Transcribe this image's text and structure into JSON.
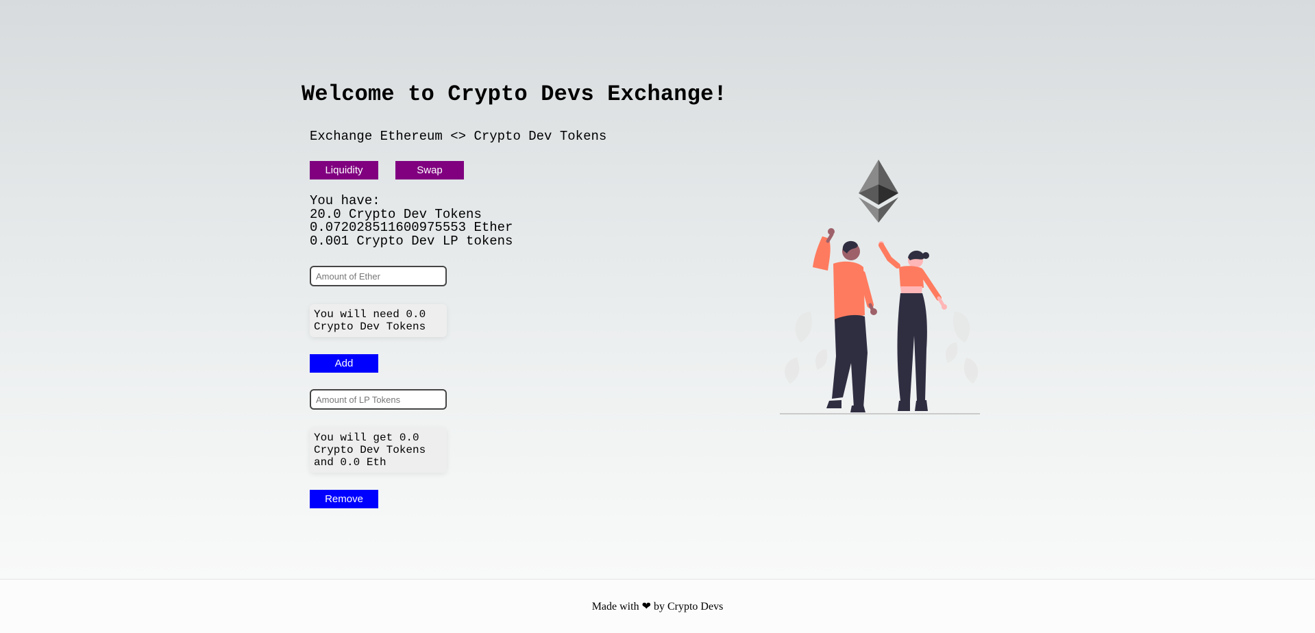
{
  "header": {
    "title": "Welcome to Crypto Devs Exchange!",
    "subtitle": "Exchange Ethereum <> Crypto Dev Tokens"
  },
  "tabs": {
    "liquidity_label": "Liquidity",
    "swap_label": "Swap"
  },
  "balances": {
    "heading": "You have:",
    "cd_tokens": "20.0 Crypto Dev Tokens",
    "ether": "0.072028511600975553 Ether",
    "lp_tokens": "0.001 Crypto Dev LP tokens"
  },
  "add_liquidity": {
    "ether_value": "",
    "ether_placeholder": "Amount of Ether",
    "need_text": "You will need 0.0 Crypto Dev Tokens",
    "add_label": "Add"
  },
  "remove_liquidity": {
    "lp_value": "",
    "lp_placeholder": "Amount of LP Tokens",
    "get_text": "You will get 0.0 Crypto Dev Tokens and 0.0 Eth",
    "remove_label": "Remove"
  },
  "footer": {
    "text": "Made with ❤ by Crypto Devs"
  },
  "colors": {
    "tab_button": "#800080",
    "action_button": "#0000ff",
    "shirt": "#ff7b5f",
    "pants": "#2f2e41"
  },
  "illustration": {
    "icon": "ethereum-icon"
  }
}
